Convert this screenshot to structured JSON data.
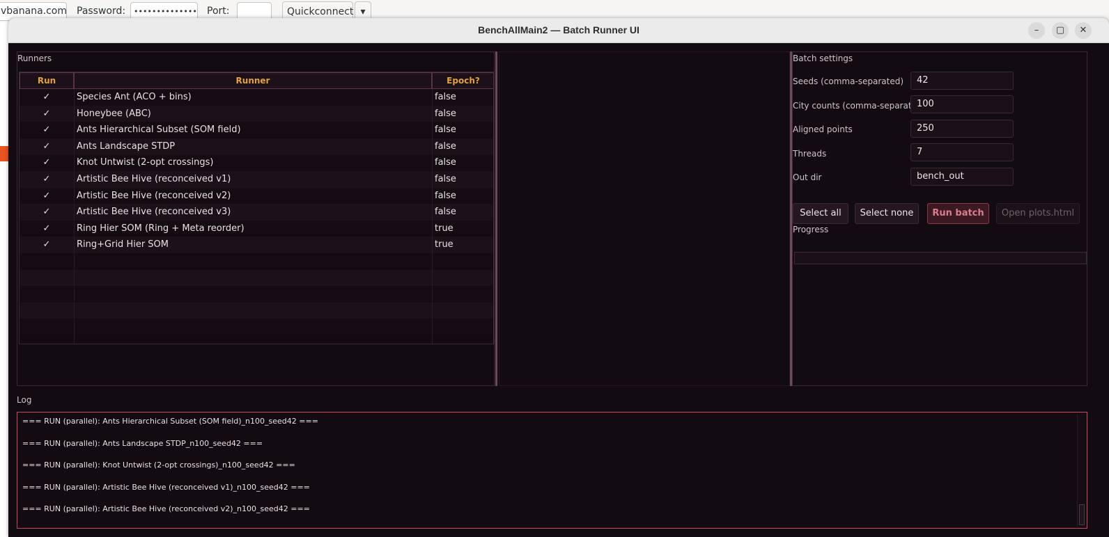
{
  "bg_toolbar": {
    "host_value": "vbanana.com",
    "password_label": "Password:",
    "password_value": "••••••••••••••••",
    "port_label": "Port:",
    "port_value": "",
    "quickconnect_label": "Quickconnect"
  },
  "window": {
    "title": "BenchAllMain2 — Batch Runner UI"
  },
  "runners": {
    "section_label": "Runners",
    "columns": [
      "Run",
      "Runner",
      "Epoch?"
    ],
    "rows": [
      {
        "run": "✓",
        "runner": "Species Ant (ACO + bins)",
        "epoch": "false"
      },
      {
        "run": "✓",
        "runner": "Honeybee (ABC)",
        "epoch": "false"
      },
      {
        "run": "✓",
        "runner": "Ants Hierarchical Subset (SOM field)",
        "epoch": "false"
      },
      {
        "run": "✓",
        "runner": "Ants Landscape STDP",
        "epoch": "false"
      },
      {
        "run": "✓",
        "runner": "Knot Untwist (2-opt crossings)",
        "epoch": "false"
      },
      {
        "run": "✓",
        "runner": "Artistic Bee Hive (reconceived v1)",
        "epoch": "false"
      },
      {
        "run": "✓",
        "runner": "Artistic Bee Hive (reconceived v2)",
        "epoch": "false"
      },
      {
        "run": "✓",
        "runner": "Artistic Bee Hive (reconceived v3)",
        "epoch": "false"
      },
      {
        "run": "✓",
        "runner": "Ring Hier SOM (Ring + Meta reorder)",
        "epoch": "true"
      },
      {
        "run": "✓",
        "runner": "Ring+Grid Hier SOM",
        "epoch": "true"
      }
    ]
  },
  "settings": {
    "section_label": "Batch settings",
    "fields": [
      {
        "label": "Seeds (comma-separated)",
        "value": "42"
      },
      {
        "label": "City counts (comma-separated)",
        "value": "100"
      },
      {
        "label": "Aligned points",
        "value": "250"
      },
      {
        "label": "Threads",
        "value": "7"
      },
      {
        "label": "Out dir",
        "value": "bench_out"
      }
    ],
    "buttons": {
      "select_all": "Select all",
      "select_none": "Select none",
      "run_batch": "Run batch",
      "open_plots": "Open plots.html"
    },
    "progress_label": "Progress",
    "progress_value": 0
  },
  "log": {
    "section_label": "Log",
    "lines": [
      "=== RUN (parallel): Ants Hierarchical Subset (SOM field)_n100_seed42 ===",
      "=== RUN (parallel): Ants Landscape STDP_n100_seed42 ===",
      "=== RUN (parallel): Knot Untwist (2-opt crossings)_n100_seed42 ===",
      "=== RUN (parallel): Artistic Bee Hive (reconceived v1)_n100_seed42 ===",
      "=== RUN (parallel): Artistic Bee Hive (reconceived v2)_n100_seed42 ==="
    ]
  }
}
